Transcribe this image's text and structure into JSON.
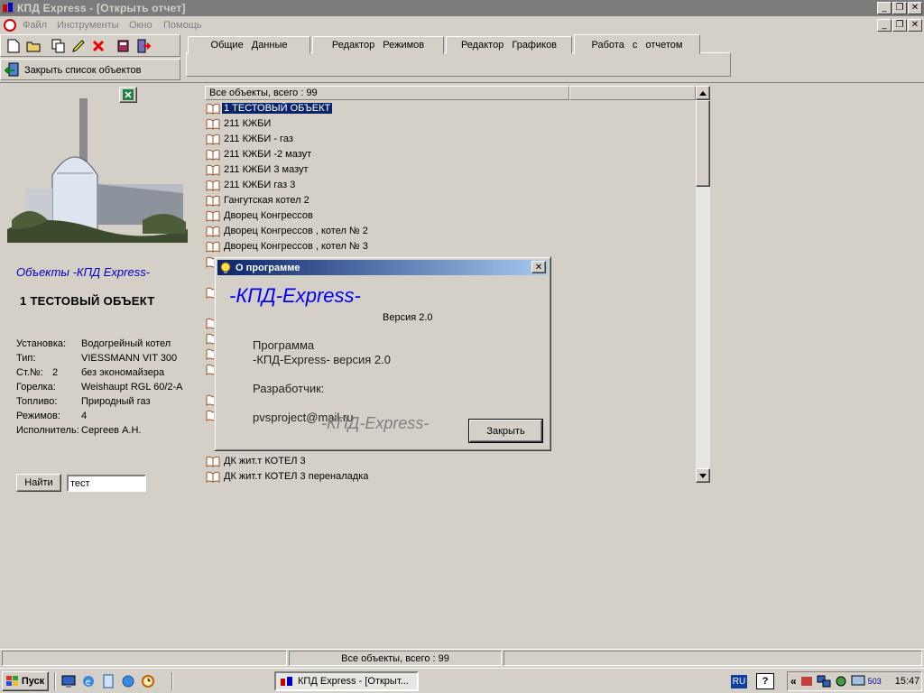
{
  "window": {
    "title": "КПД Express - [Открыть  отчет]",
    "buttons": [
      "_",
      "❐",
      "✕"
    ]
  },
  "menu": [
    "Файл",
    "Инструменты",
    "Окно",
    "Помощь"
  ],
  "toolbar": {
    "close_list_label": "Закрыть список объектов"
  },
  "tabs": [
    "Общие Данные",
    "Редактор Режимов",
    "Редактор Графиков",
    "Работа с отчетом"
  ],
  "left_panel": {
    "heading": "Объекты -КПД Express-",
    "object_name": "1 ТЕСТОВЫЙ ОБЪЕКТ",
    "props": [
      {
        "label": "Установка:",
        "value": "Водогрейный котел"
      },
      {
        "label": "Тип:",
        "value": "VIESSMANN VIT 300"
      },
      {
        "label": "Ст.№:",
        "num": "2",
        "value": "без экономайзера"
      },
      {
        "label": "Горелка:",
        "value": "Weishaupt RGL 60/2-A"
      },
      {
        "label": "Топливо:",
        "value": "Природный газ"
      },
      {
        "label": "Режимов:",
        "value": "4"
      },
      {
        "label": "Исполнитель:",
        "value": "Сергеев А.Н."
      }
    ],
    "find_button": "Найти",
    "find_value": "тест"
  },
  "list": {
    "header": "Все объекты, всего :  99",
    "items": [
      "1 ТЕСТОВЫЙ ОБЪЕКТ",
      "211 КЖБИ",
      "211 КЖБИ - газ",
      "211 КЖБИ -2 мазут",
      "211 КЖБИ 3 мазут",
      "211 КЖБИ газ 3",
      "Гангутская котел 2",
      "Дворец Конгрессов",
      "Дворец Конгрессов , котел № 2",
      "Дворец Конгрессов , котел № 3",
      "ДК жит.т КОТЕЛ 3",
      "ДК жит.т КОТЕЛ 3 переналадка"
    ],
    "selected_index": 0
  },
  "dialog": {
    "title": "О программе",
    "app_name": "-КПД-Express-",
    "version": "Версия 2.0",
    "line1": "Программа",
    "line2": "-КПД-Express-  версия 2.0",
    "line3": "Разработчик:",
    "email": "pvsproject@mail.ru",
    "watermark": "-КПД-Express-",
    "close_button": "Закрыть"
  },
  "status": {
    "text": "Все объекты, всего :  99"
  },
  "taskbar": {
    "start": "Пуск",
    "task": "КПД Express - [Открыт...",
    "lang": "RU",
    "help": "?",
    "tray_number": "503",
    "clock": "15:47",
    "chevron": "«"
  },
  "colors": {
    "selection": "#0a246a",
    "dialog_heading": "#0000ff",
    "left_heading": "#0000c0"
  }
}
